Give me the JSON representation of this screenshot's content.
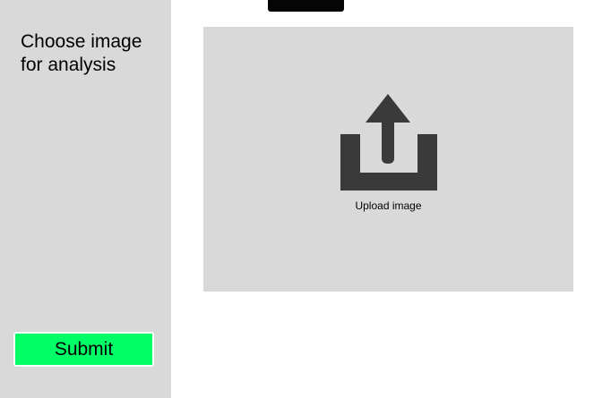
{
  "sidebar": {
    "title": "Choose image for analysis",
    "submit_label": "Submit"
  },
  "upload": {
    "label": "Upload image",
    "icon": "upload-icon"
  },
  "colors": {
    "sidebar_background": "#d9d9d9",
    "upload_background": "#d9d9d9",
    "submit_background": "#00ff66",
    "icon_color": "#3a3a3a"
  }
}
